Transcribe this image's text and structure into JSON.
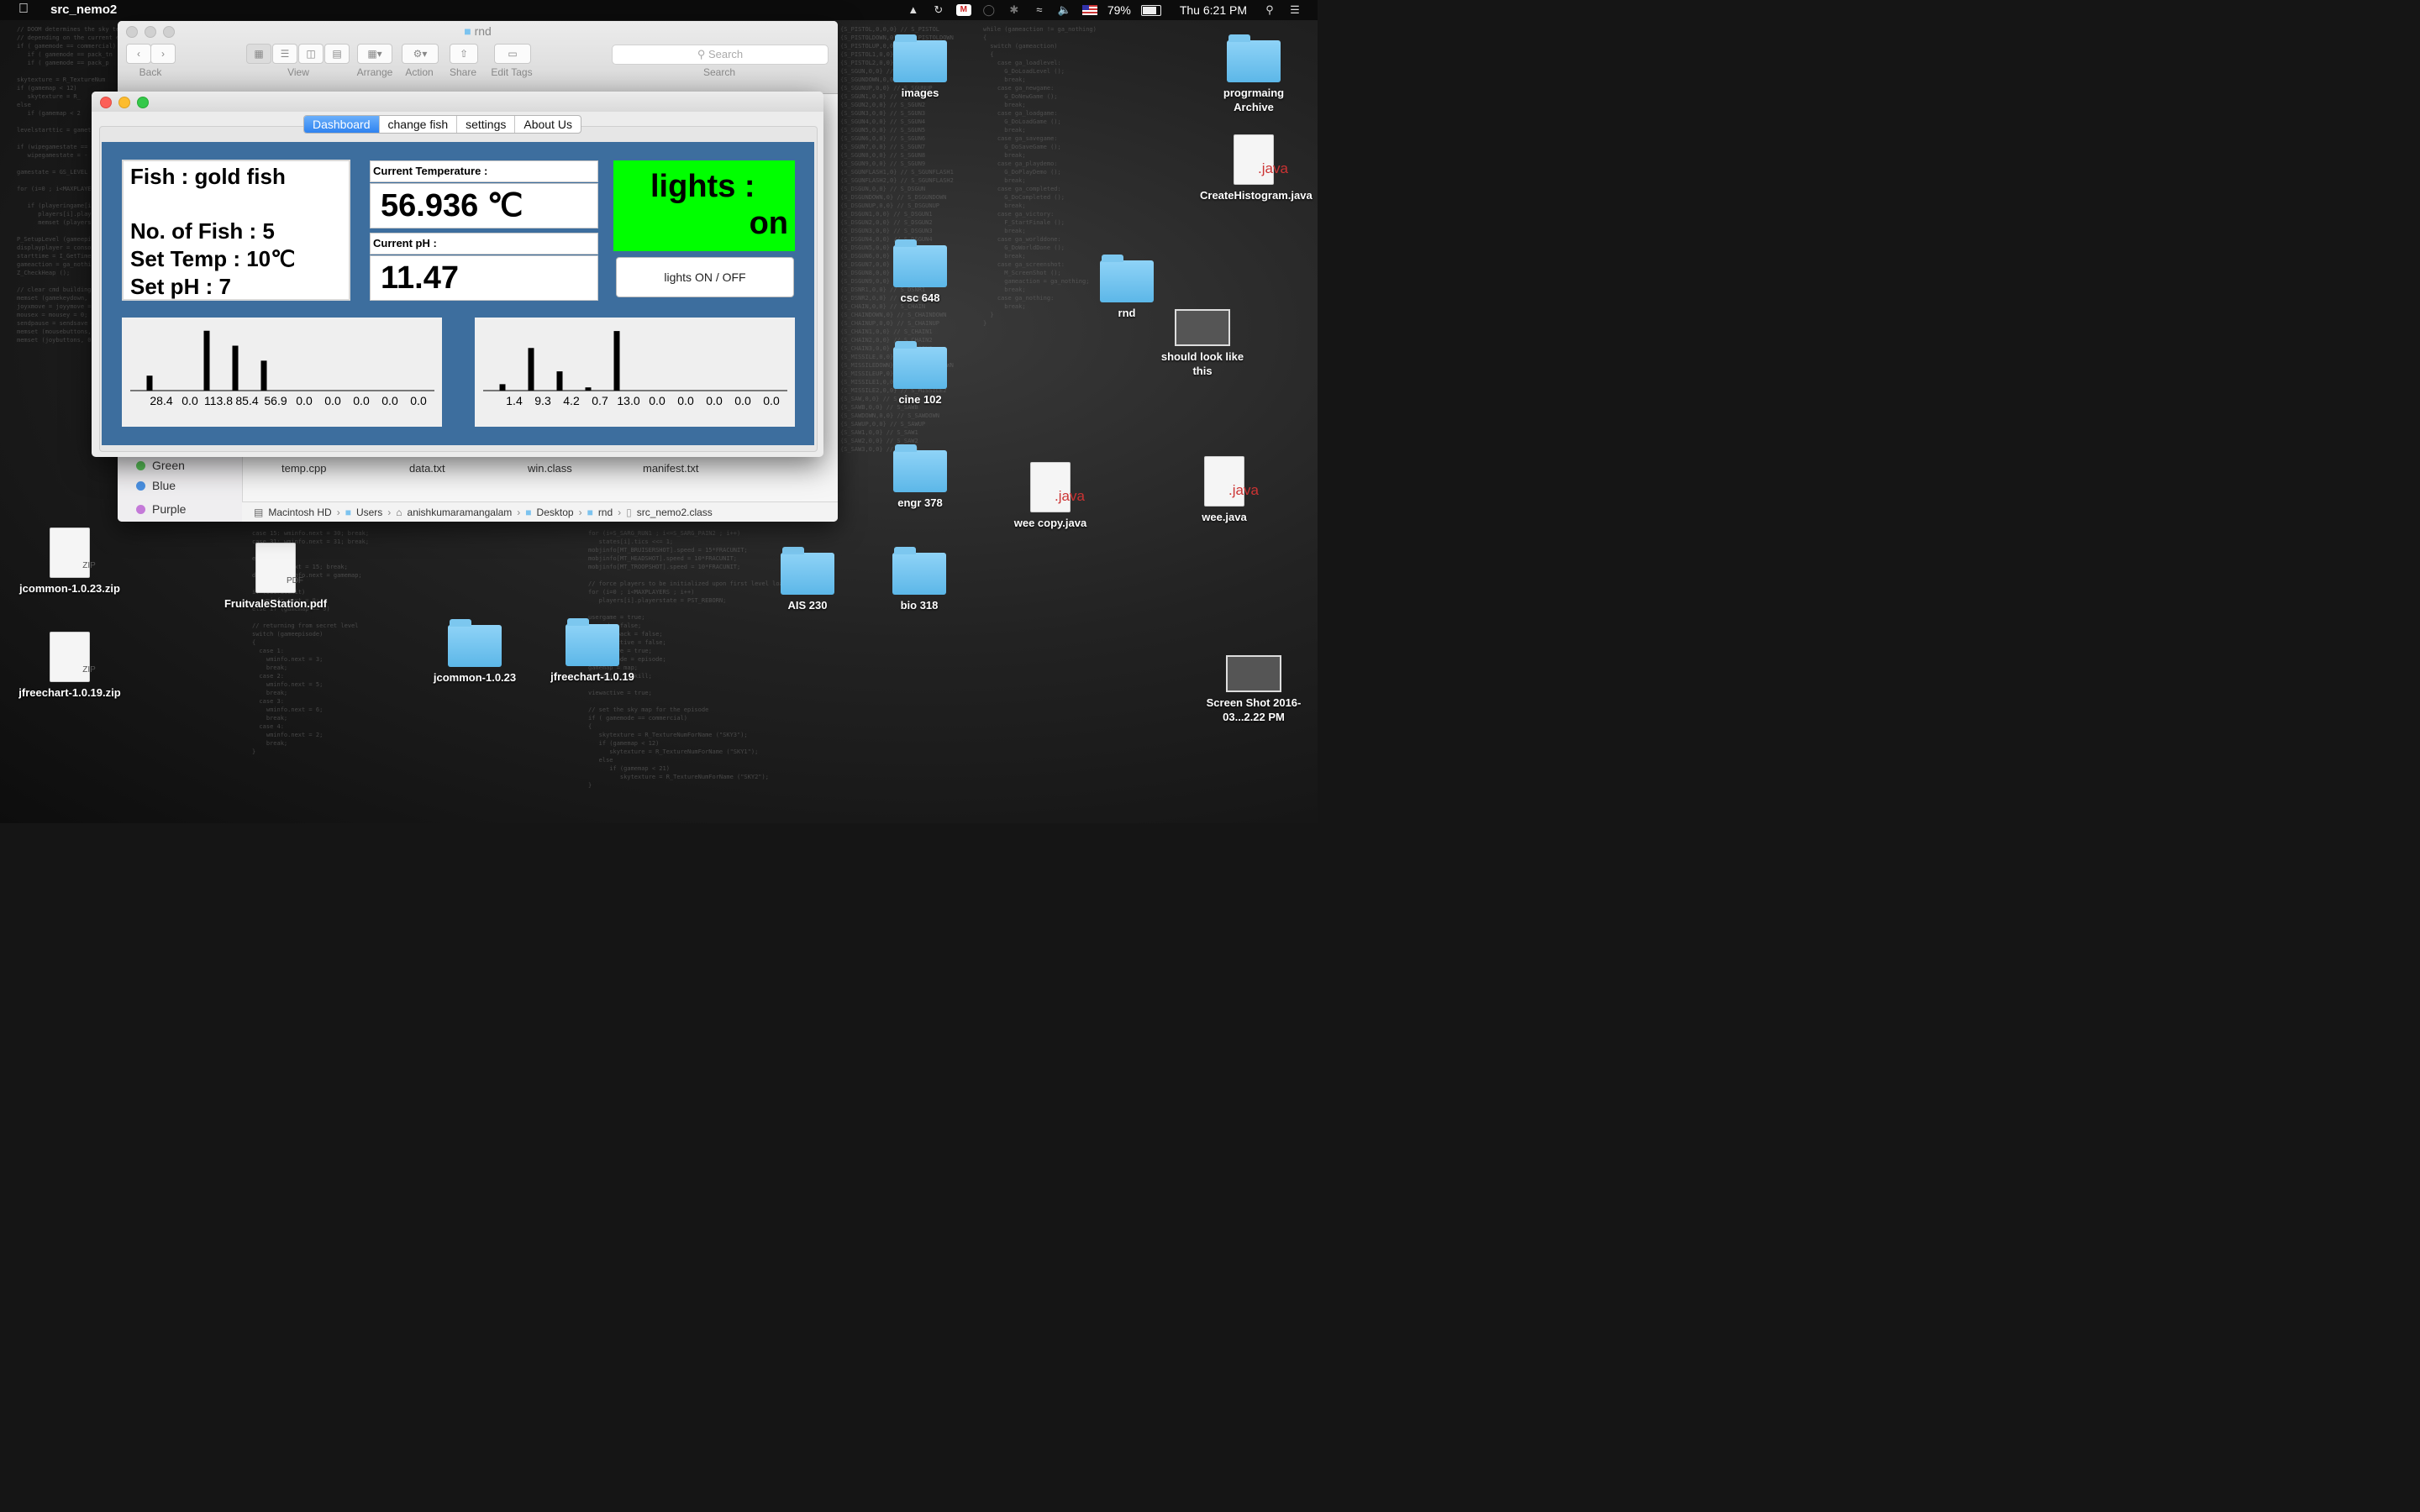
{
  "menubar": {
    "app_name": "src_nemo2",
    "battery": "79%",
    "battery_level": 0.79,
    "clock": "Thu 6:21 PM",
    "icons": [
      "apple-icon",
      "google-drive-icon",
      "sync-icon",
      "mcafee-shield-icon",
      "messages-icon",
      "bluetooth-icon",
      "wifi-icon",
      "volume-icon",
      "us-flag-icon",
      "battery-icon",
      "search-icon",
      "list-icon"
    ]
  },
  "finder": {
    "title": "rnd",
    "toolbar": {
      "back_label": "Back",
      "view_label": "View",
      "arrange_label": "Arrange",
      "action_label": "Action",
      "share_label": "Share",
      "edit_tags_label": "Edit Tags",
      "search_placeholder": "Search",
      "search_label": "Search"
    },
    "sidebar_tags": [
      {
        "label": "Green",
        "color": "#5ac35a"
      },
      {
        "label": "Blue",
        "color": "#4a90e2"
      },
      {
        "label": "Purple",
        "color": "#c47ad8"
      }
    ],
    "files": [
      "temp.cpp",
      "data.txt",
      "win.class",
      "manifest.txt"
    ],
    "path": [
      "Macintosh HD",
      "Users",
      "anishkumaramangalam",
      "Desktop",
      "rnd",
      "src_nemo2.class"
    ]
  },
  "app": {
    "tabs": [
      "Dashboard",
      "change fish",
      "settings",
      "About Us"
    ],
    "active_tab": "Dashboard",
    "fish_label": "Fish : gold fish",
    "num_fish": "No. of Fish : 5",
    "set_temp": "Set Temp : 10℃",
    "set_ph": "Set pH : 7",
    "current_temp_label": "Current Temperature :",
    "current_temp_value": "56.936 ℃",
    "current_ph_label": "Current pH :",
    "current_ph_value": "11.47",
    "lights_label": "lights :",
    "lights_state": "on",
    "lights_button": "lights ON / OFF",
    "lights_color": "#00ff00",
    "panel_color": "#3d6e9e"
  },
  "chart_data": [
    {
      "type": "bar",
      "categories": [
        "28.4",
        "0.0",
        "113.8",
        "85.4",
        "56.9",
        "0.0",
        "0.0",
        "0.0",
        "0.0",
        "0.0"
      ],
      "values": [
        28.4,
        0.0,
        113.8,
        85.4,
        56.9,
        0.0,
        0.0,
        0.0,
        0.0,
        0.0
      ],
      "ylim": [
        0,
        115
      ]
    },
    {
      "type": "bar",
      "categories": [
        "1.4",
        "9.3",
        "4.2",
        "0.7",
        "13.0",
        "0.0",
        "0.0",
        "0.0",
        "0.0",
        "0.0"
      ],
      "values": [
        1.4,
        9.3,
        4.2,
        0.7,
        13.0,
        0.0,
        0.0,
        0.0,
        0.0,
        0.0
      ],
      "ylim": [
        0,
        13.2
      ]
    }
  ],
  "desktop_icons": {
    "images": "images",
    "progr_archive": "progrmaing Archive",
    "create_histogram": "CreateHistogram.java",
    "csc648": "csc 648",
    "rnd": "rnd",
    "should_look": "should look like this",
    "cine102": "cine 102",
    "engr378": "engr 378",
    "wee_copy": "wee copy.java",
    "wee": "wee.java",
    "ais230": "AIS 230",
    "bio318": "bio 318",
    "jcommon_zip": "jcommon-1.0.23.zip",
    "fruitvale": "FruitvaleStation.pdf",
    "jcommon": "jcommon-1.0.23",
    "jfreechart": "jfreechart-1.0.19",
    "jfreechart_zip": "jfreechart-1.0.19.zip",
    "screenshot": "Screen Shot 2016-03...2.22 PM",
    "java_ext": ".java",
    "zip_ext": "ZIP",
    "pdf_ext": "PDF"
  }
}
